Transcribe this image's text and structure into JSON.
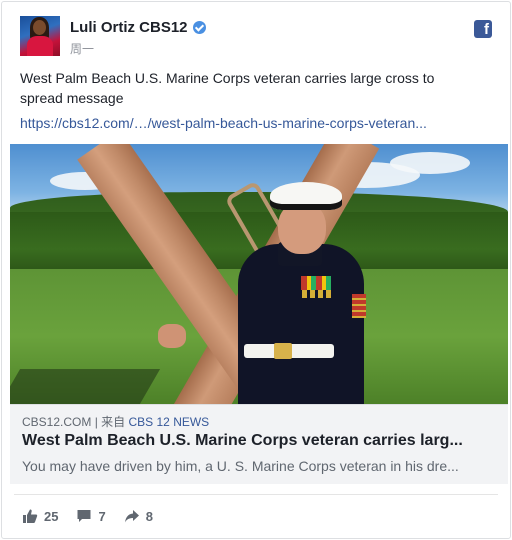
{
  "post": {
    "page_name": "Luli Ortiz CBS12",
    "timestamp": "周一",
    "text": "West Palm Beach U.S. Marine Corps veteran carries large cross to spread message",
    "link_text": "https://cbs12.com/…/west-palm-beach-us-marine-corps-veteran..."
  },
  "preview": {
    "domain": "CBS12.COM",
    "separator": " | ",
    "via_label": "来自 ",
    "source": "CBS 12 NEWS",
    "title": "West Palm Beach U.S. Marine Corps veteran carries larg...",
    "description": "You may have driven by him, a U. S. Marine Corps veteran in his dre..."
  },
  "stats": {
    "likes": "25",
    "comments": "7",
    "shares": "8"
  },
  "icons": {
    "verified": "verified-badge-icon",
    "facebook": "facebook-logo-icon",
    "like": "thumbs-up-icon",
    "comment": "comment-bubble-icon",
    "share": "share-arrow-icon"
  },
  "colors": {
    "brand": "#3b5998",
    "link": "#365899",
    "verified": "#4a90e2",
    "muted": "#90949c"
  }
}
